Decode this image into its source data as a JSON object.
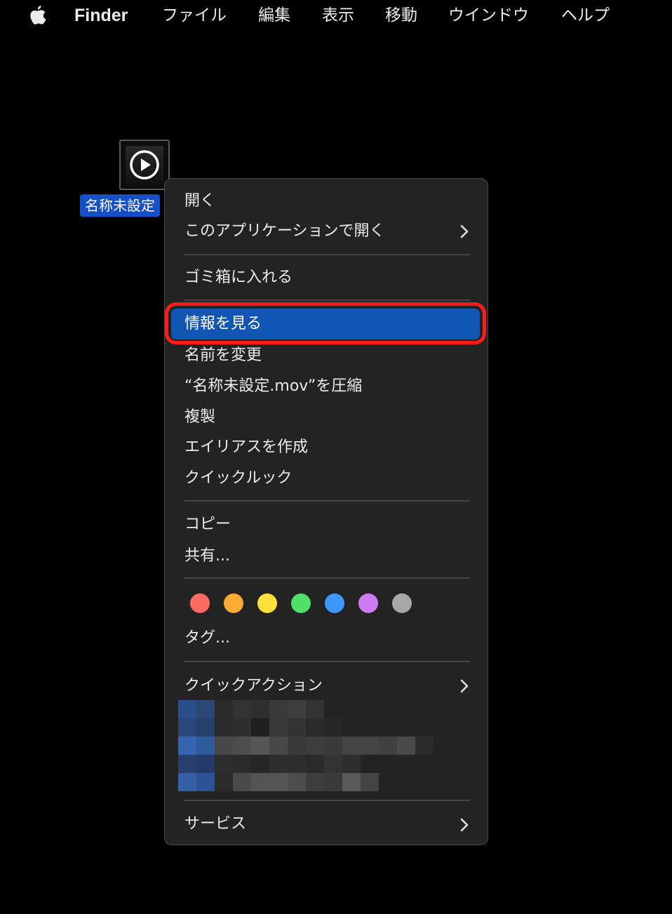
{
  "menubar": {
    "app_name": "Finder",
    "items": [
      "ファイル",
      "編集",
      "表示",
      "移動",
      "ウインドウ",
      "ヘルプ"
    ]
  },
  "desktop": {
    "file_label": "名称未設定"
  },
  "context_menu": {
    "open": "開く",
    "open_with": "このアプリケーションで開く",
    "move_to_trash": "ゴミ箱に入れる",
    "get_info": "情報を見る",
    "rename": "名前を変更",
    "compress": "“名称未設定.mov”を圧縮",
    "duplicate": "複製",
    "make_alias": "エイリアスを作成",
    "quick_look": "クイックルック",
    "copy": "コピー",
    "share": "共有...",
    "tags": "タグ...",
    "quick_actions": "クイックアクション",
    "services": "サービス",
    "tag_colors": [
      {
        "name": "red",
        "color": "#ff6b60"
      },
      {
        "name": "orange",
        "color": "#fdab33"
      },
      {
        "name": "yellow",
        "color": "#fde13a"
      },
      {
        "name": "green",
        "color": "#4ee16a"
      },
      {
        "name": "blue",
        "color": "#3c9aff"
      },
      {
        "name": "purple",
        "color": "#d07cf4"
      },
      {
        "name": "gray",
        "color": "#a8a8aa"
      }
    ]
  },
  "colors": {
    "highlight": "#1155b5",
    "annotation_box": "#ff1a1a",
    "selection_label": "#1650c9"
  }
}
